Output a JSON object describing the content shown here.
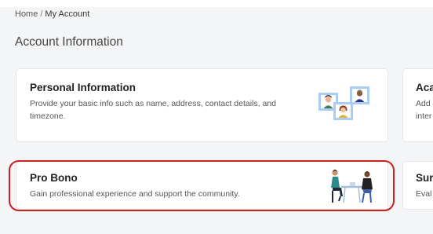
{
  "breadcrumb": {
    "home": "Home",
    "separator": "/",
    "current": "My Account"
  },
  "page_title": "Account Information",
  "cards": {
    "personal": {
      "title": "Personal Information",
      "description": "Provide your basic info such as name, address, contact details, and timezone.",
      "illustration": "profile-photos-illustration"
    },
    "academic": {
      "title": "Aca",
      "description_line1": "Add",
      "description_line2": "inter"
    },
    "probono": {
      "title": "Pro Bono",
      "description": "Gain professional experience and support the community.",
      "illustration": "people-at-table-illustration"
    },
    "survey": {
      "title": "Sur",
      "description": "Eval"
    }
  },
  "colors": {
    "highlight_border": "#cc1f1f",
    "photo_frame": "#a9cdf5"
  }
}
